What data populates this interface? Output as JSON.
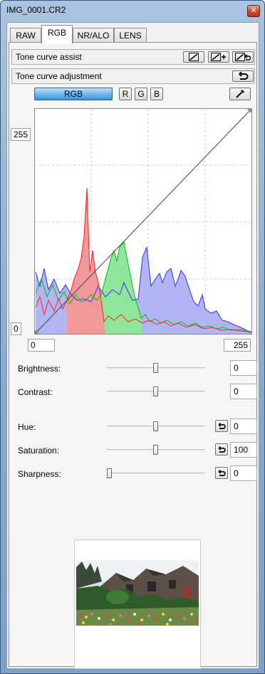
{
  "window": {
    "title": "IMG_0001.CR2"
  },
  "tabs": [
    {
      "label": "RAW",
      "active": false
    },
    {
      "label": "RGB",
      "active": true
    },
    {
      "label": "NR/ALO",
      "active": false
    },
    {
      "label": "LENS",
      "active": false
    }
  ],
  "tone_curve_assist": {
    "label": "Tone curve assist"
  },
  "tone_curve_adjustment": {
    "label": "Tone curve adjustment"
  },
  "channels": {
    "rgb": "RGB",
    "r": "R",
    "g": "G",
    "b": "B",
    "selected": "RGB"
  },
  "curve": {
    "input_min": "0",
    "input_max": "255",
    "output_min": "0",
    "output_max": "255"
  },
  "controls": {
    "brightness": {
      "label": "Brightness:",
      "value": "0",
      "position": 0.5
    },
    "contrast": {
      "label": "Contrast:",
      "value": "0",
      "position": 0.5
    },
    "hue": {
      "label": "Hue:",
      "value": "0",
      "position": 0.5
    },
    "saturation": {
      "label": "Saturation:",
      "value": "100",
      "position": 0.5
    },
    "sharpness": {
      "label": "Sharpness:",
      "value": "0",
      "position": 0.0
    }
  },
  "colors": {
    "histogram_red": "#f29a9a",
    "histogram_green": "#8fe69a",
    "histogram_blue": "#b2b5f3",
    "line_red": "#ff2020",
    "line_green": "#00c000",
    "line_blue": "#3030ff",
    "accent": "#3c94d8"
  },
  "icons": {
    "auto_curve": "auto-curve-icon",
    "auto_curve_plus": "auto-curve-plus-icon",
    "curve_reset": "curve-reset-icon",
    "reset": "reset-arrow-icon",
    "eyedropper": "eyedropper-icon"
  }
}
